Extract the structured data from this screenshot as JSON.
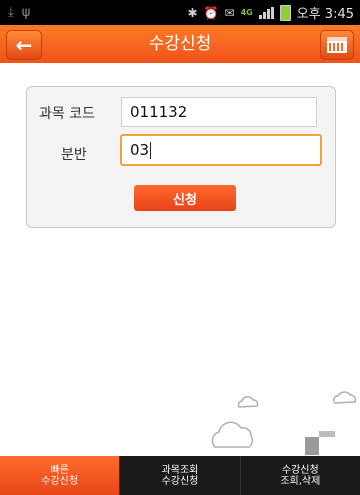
{
  "status_bar": {
    "net_type": "4G",
    "clock": "오후 3:45",
    "icons": [
      "usb-icon",
      "bluetooth-icon",
      "alarm-icon",
      "message-icon",
      "signal-icon",
      "battery-icon"
    ]
  },
  "header": {
    "title": "수강신청",
    "back_icon": "left-arrow-icon",
    "calendar_icon": "calendar-icon",
    "accent_color": "#f0541b"
  },
  "form": {
    "course_code_label": "과목 코드",
    "course_code_value": "011132",
    "section_label": "분반",
    "section_value": "03",
    "submit_label": "신청"
  },
  "tabs": [
    {
      "line1": "빠른",
      "line2": "수강신청",
      "active": true
    },
    {
      "line1": "과목조회",
      "line2": "수강신청",
      "active": false
    },
    {
      "line1": "수강신청",
      "line2": "조회,삭제",
      "active": false
    }
  ]
}
